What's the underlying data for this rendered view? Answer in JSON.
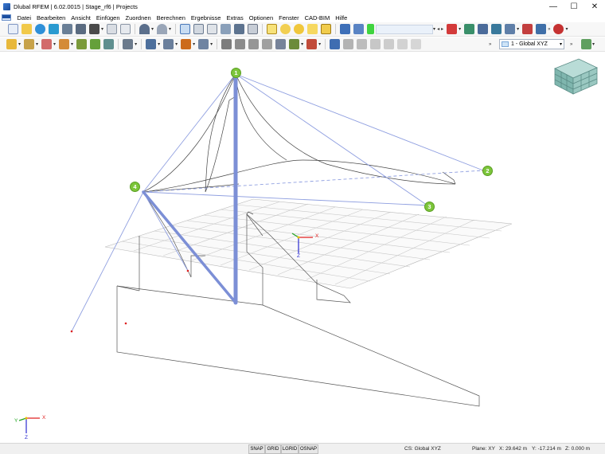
{
  "window": {
    "title": "Dlubal RFEM | 6.02.0015 | Stage_rf6 | Projects",
    "min": "—",
    "max": "☐",
    "close": "✕"
  },
  "menu": [
    "Datei",
    "Bearbeiten",
    "Ansicht",
    "Einfügen",
    "Zuordnen",
    "Berechnen",
    "Ergebnisse",
    "Extras",
    "Optionen",
    "Fenster",
    "CAD-BIM",
    "Hilfe"
  ],
  "toolbar": {
    "view_select": "1 - Global XYZ",
    "overflow": "»"
  },
  "nodes": [
    "1",
    "2",
    "3",
    "4"
  ],
  "axes": {
    "x": "X",
    "y": "Y",
    "z": "Z"
  },
  "status": {
    "snap": "SNAP",
    "grid": "GRID",
    "lgrid": "LGRID",
    "osnap": "OSNAP",
    "cs": "CS: Global XYZ",
    "plane": "Plane: XY",
    "x": "X: 29.642 m",
    "y": "Y: -17.214 m",
    "z": "Z: 0.000 m"
  },
  "colors": {
    "member": "#7c8fd6",
    "node": "#7cc53a",
    "cable": "#8f9fe0"
  }
}
